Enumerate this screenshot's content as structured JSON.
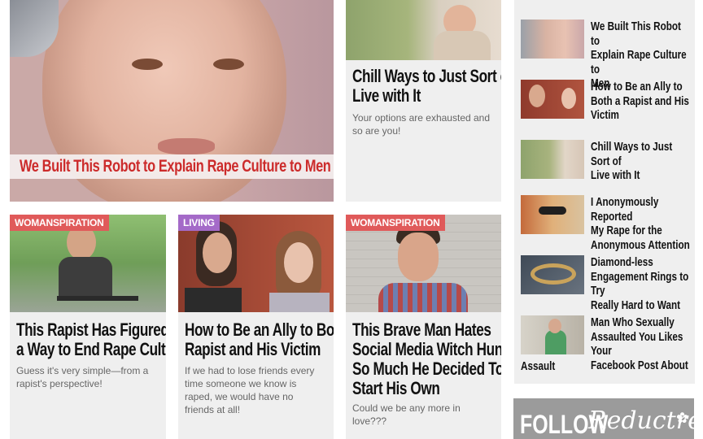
{
  "hero": {
    "title": "We Built This Robot to Explain Rape Culture to Men"
  },
  "top_card": {
    "title_line1": "Chill Ways to Just Sort of",
    "title_line2": "Live with It",
    "dek_line1": "Your options are exhausted and",
    "dek_line2": "so are you!"
  },
  "cards": [
    {
      "tag": "WOMANSPIRATION",
      "title_line1": "This Rapist Has Figured Out",
      "title_line2": "a Way to End Rape Culture",
      "dek_line1": "Guess it's very simple—from a",
      "dek_line2": "rapist's perspective!"
    },
    {
      "tag": "LIVING",
      "title_line1": "How to Be an Ally to Both a",
      "title_line2": "Rapist and His Victim",
      "dek_line1": "If we had to lose friends every",
      "dek_line2": "time someone we know is",
      "dek_line3": "raped, we would have no",
      "dek_line4": "friends at all!"
    },
    {
      "tag": "WOMANSPIRATION",
      "title_line1": "This Brave Man Hates",
      "title_line2": "Social Media Witch Hunts",
      "title_line3": "So Much He Decided To",
      "title_line4": "Start His Own",
      "dek_line1": "Could we be any more in",
      "dek_line2": "love???"
    }
  ],
  "sidebar": {
    "items": [
      {
        "l1": "We Built This Robot to",
        "l2": "Explain Rape Culture to",
        "l3": "Men"
      },
      {
        "l1": "How to Be an Ally to",
        "l2": "Both a Rapist and His",
        "l3": "Victim"
      },
      {
        "l1": "Chill Ways to Just Sort of",
        "l2": "Live with It",
        "l3": ""
      },
      {
        "l1": "I Anonymously Reported",
        "l2": "My Rape for the",
        "l3": "Anonymous Attention"
      },
      {
        "l1": "Diamond-less",
        "l2": "Engagement Rings to Try",
        "l3": "Really Hard to Want"
      },
      {
        "l1": "Man Who Sexually",
        "l2": "Assaulted You Likes Your",
        "l3": "Facebook Post About",
        "l4": "Assault"
      }
    ]
  },
  "follow": {
    "label": "FOLLOW",
    "brand": "Reductress",
    "flower_icon": "flower-icon"
  },
  "colors": {
    "accent_red": "#cc2b2b",
    "tag_red": "#e05a5a",
    "tag_purple": "#a46ac8",
    "follow_grey": "#9b9b9b"
  }
}
